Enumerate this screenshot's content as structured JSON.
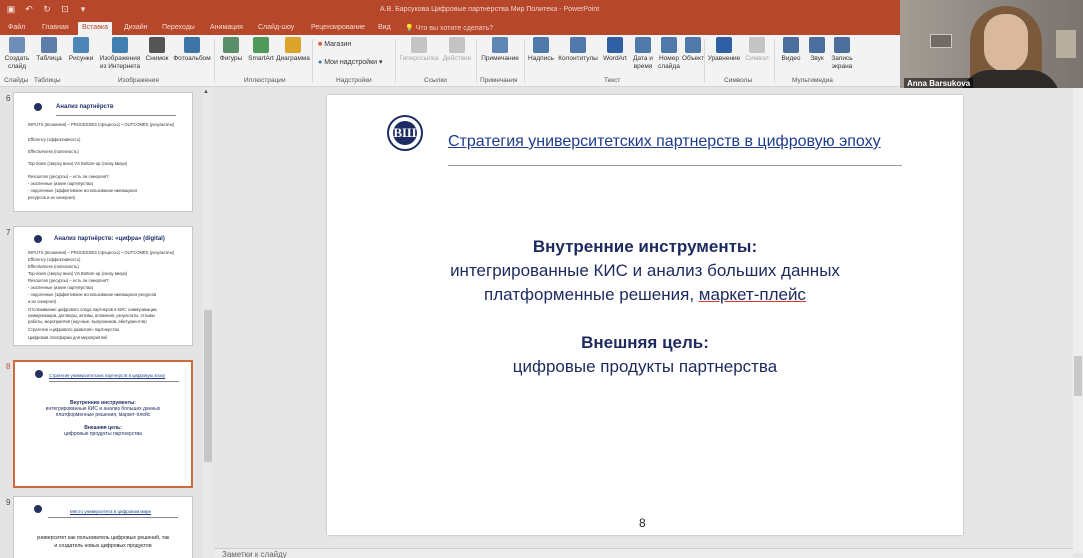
{
  "window": {
    "title": "А.В. Барсукова Цифровые партнерства Мир Политека - PowerPoint",
    "tell_me": "Что вы хотите сделать?"
  },
  "tabs": [
    "Файл",
    "Главная",
    "Вставка",
    "Дизайн",
    "Переходы",
    "Анимация",
    "Слайд-шоу",
    "Рецензирование",
    "Вид"
  ],
  "active_tab": "Вставка",
  "ribbon": {
    "buttons": [
      {
        "label": "Создать слайд",
        "icon": "new-slide-icon",
        "color": "#6f8fb8"
      },
      {
        "label": "Таблица",
        "icon": "table-icon",
        "color": "#5c7ea8"
      },
      {
        "label": "Рисунки",
        "icon": "pictures-icon",
        "color": "#4d86b7"
      },
      {
        "label": "Изображения из Интернета",
        "icon": "online-pictures-icon",
        "color": "#3f7fb1"
      },
      {
        "label": "Снимок",
        "icon": "screenshot-icon",
        "color": "#555555"
      },
      {
        "label": "Фотоальбом",
        "icon": "photo-album-icon",
        "color": "#3d76a5"
      },
      {
        "label": "Фигуры",
        "icon": "shapes-icon",
        "color": "#5a8f6a"
      },
      {
        "label": "SmartArt",
        "icon": "smartart-icon",
        "color": "#4f9a5a"
      },
      {
        "label": "Диаграмма",
        "icon": "chart-icon",
        "color": "#d9a32c"
      },
      {
        "label": "Магазин",
        "icon": "store-icon",
        "color": "#d9542c"
      },
      {
        "label": "Мои надстройки",
        "icon": "addins-icon",
        "color": "#3a6fb5"
      },
      {
        "label": "Гиперссылка",
        "icon": "hyperlink-icon",
        "color": "#a0a0a0"
      },
      {
        "label": "Действие",
        "icon": "action-icon",
        "color": "#a0a0a0"
      },
      {
        "label": "Примечание",
        "icon": "comment-icon",
        "color": "#5f86b5"
      },
      {
        "label": "Надпись",
        "icon": "textbox-icon",
        "color": "#5078a8"
      },
      {
        "label": "Колонтитулы",
        "icon": "header-footer-icon",
        "color": "#5078a8"
      },
      {
        "label": "WordArt",
        "icon": "wordart-icon",
        "color": "#2f5fa5"
      },
      {
        "label": "Дата и время",
        "icon": "datetime-icon",
        "color": "#5078a8"
      },
      {
        "label": "Номер слайда",
        "icon": "slide-number-icon",
        "color": "#5078a8"
      },
      {
        "label": "Объект",
        "icon": "object-icon",
        "color": "#5078a8"
      },
      {
        "label": "Уравнение",
        "icon": "equation-icon",
        "color": "#2f5fa5"
      },
      {
        "label": "Символ",
        "icon": "symbol-icon",
        "color": "#a0a0a0"
      },
      {
        "label": "Видео",
        "icon": "video-icon",
        "color": "#4b6e9c"
      },
      {
        "label": "Звук",
        "icon": "audio-icon",
        "color": "#4b6e9c"
      },
      {
        "label": "Запись экрана",
        "icon": "screen-record-icon",
        "color": "#4b6e9c"
      }
    ],
    "groups": [
      "Слайды",
      "Таблицы",
      "Изображения",
      "Иллюстрации",
      "Надстройки",
      "Ссылки",
      "Примечания",
      "Текст",
      "Символы",
      "Мультимедиа"
    ]
  },
  "webcam": {
    "participant_name": "Anna Barsukova"
  },
  "thumbnails": [
    {
      "number": "6",
      "title": "Анализ партнёрств",
      "lines": [
        "INPUTS (вложения) – PROCESSES (процессы) – OUTCOMES (результаты)",
        "Efficiency (эффективность)",
        "Effectiveness (полезность)",
        "Top-down (сверху вниз) VS Bottom-up (снизу вверх)",
        "Resources (ресурсы) – есть ли синергия?:",
        "  - экзогенные (извне партнёрства)",
        "  - эндогенные (эффективное использование имеющихся",
        "ресурсов и их синергия)"
      ]
    },
    {
      "number": "7",
      "title": "Анализ партнёрств: «цифра» (digital)",
      "lines": [
        "INPUTS (вложения) – PROCESSES (процессы) – OUTCOMES (результаты)",
        "Efficiency (эффективность)",
        "Effectiveness (полезность)",
        "Top-down (сверху вниз) VS Bottom-up (снизу вверх)",
        "Resources (ресурсы) – есть ли синергия?:",
        "  - экзогенные (извне партнёрства)",
        "  - эндогенные (эффективное использование имеющихся ресурсов",
        "и их синергия)",
        "Отслеживание цифрового следа партнеров в КИС: коммуникации,",
        "коммуникации, договоры, активы, вложения, результаты, отзывы",
        "работы, мероприятия (научные, выпускников, абитуриентов)",
        "Стратегия «цифрового развития» партнерства",
        "Цифровая платформа для мероприятий"
      ]
    },
    {
      "number": "8",
      "title": "Стратегия университетских партнерств в цифровую эпоху",
      "lines": [
        "Внутренние инструменты:",
        "интегрированные КИС и анализ больших данных",
        "платформенные решения, маркет-плейс",
        "Внешняя цель:",
        "цифровые продукты партнерства"
      ]
    },
    {
      "number": "9",
      "title": "Место университета в цифровом мире",
      "lines": [
        "университет как пользователь цифровых решений, так",
        "и создатель новых цифровых продуктов"
      ]
    }
  ],
  "slide": {
    "title": "Стратегия университетских партнерств в цифровую эпоху",
    "logo_letters": "ВШ",
    "heading1": "Внутренние инструменты:",
    "line1": "интегрированные КИС и анализ больших данных",
    "line2_a": "платформенные решения, ",
    "line2_b": "маркет-плейс",
    "heading2": "Внешняя цель:",
    "line3": "цифровые продукты партнерства",
    "number": "8"
  },
  "notes": {
    "placeholder": "Заметки к слайду"
  },
  "colors": {
    "accent": "#b7472a",
    "slide_text": "#1c2a5e",
    "title_link": "#1e3c8c",
    "selected_thumb": "#d0693e"
  }
}
